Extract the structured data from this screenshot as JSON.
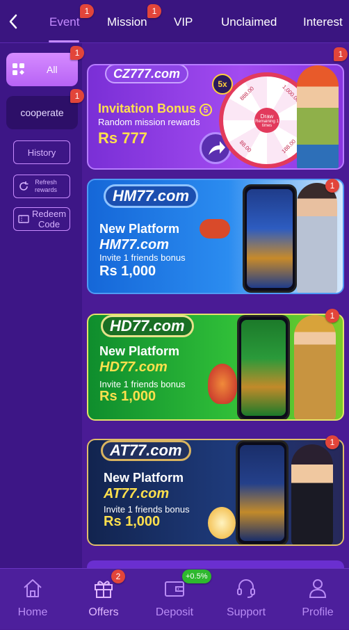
{
  "header": {
    "tabs": [
      {
        "label": "Event",
        "badge": "1"
      },
      {
        "label": "Mission",
        "badge": "1"
      },
      {
        "label": "VIP"
      },
      {
        "label": "Unclaimed"
      },
      {
        "label": "Interest"
      }
    ]
  },
  "sidebar": {
    "all_label": "All",
    "all_badge": "1",
    "cooperate_label": "cooperate",
    "cooperate_badge": "1",
    "history_label": "History",
    "refresh_label_1": "Refresh",
    "refresh_label_2": "rewards",
    "redeem_label_1": "Redeem",
    "redeem_label_2": "Code"
  },
  "banners": [
    {
      "badge": "1",
      "logo": "CZ777.com",
      "title": "Invitation Bonus",
      "title_num": "5",
      "subtitle": "Random mission rewards",
      "amount": "Rs 777",
      "multiplier": "5x",
      "wheel_center": "Draw",
      "wheel_sub": "Remaining 1 times",
      "wheel_values": [
        "888.00",
        "1,000.00",
        "188.00",
        "88.00"
      ]
    },
    {
      "badge": "1",
      "logo": "HM77.com",
      "title": "New Platform",
      "brand": "HM77.com",
      "subtitle": "Invite 1 friends bonus",
      "amount": "Rs 1,000"
    },
    {
      "badge": "1",
      "logo": "HD77.com",
      "title": "New Platform",
      "brand": "HD77.com",
      "subtitle": "Invite 1 friends bonus",
      "amount": "Rs 1,000"
    },
    {
      "badge": "1",
      "logo": "AT77.com",
      "title": "New Platform",
      "brand": "AT77.com",
      "subtitle": "Invite 1 friends bonus",
      "amount": "Rs 1,000"
    }
  ],
  "bottom_nav": [
    {
      "label": "Home",
      "icon": "home-icon"
    },
    {
      "label": "Offers",
      "icon": "gift-icon",
      "badge": "2"
    },
    {
      "label": "Deposit",
      "icon": "wallet-icon",
      "badge": "+0.5%"
    },
    {
      "label": "Support",
      "icon": "headset-icon"
    },
    {
      "label": "Profile",
      "icon": "user-icon"
    }
  ],
  "colors": {
    "background": "#4a1b95",
    "accent": "#c58bff",
    "badge_red": "#e2453a",
    "badge_green": "#2eb82e"
  }
}
